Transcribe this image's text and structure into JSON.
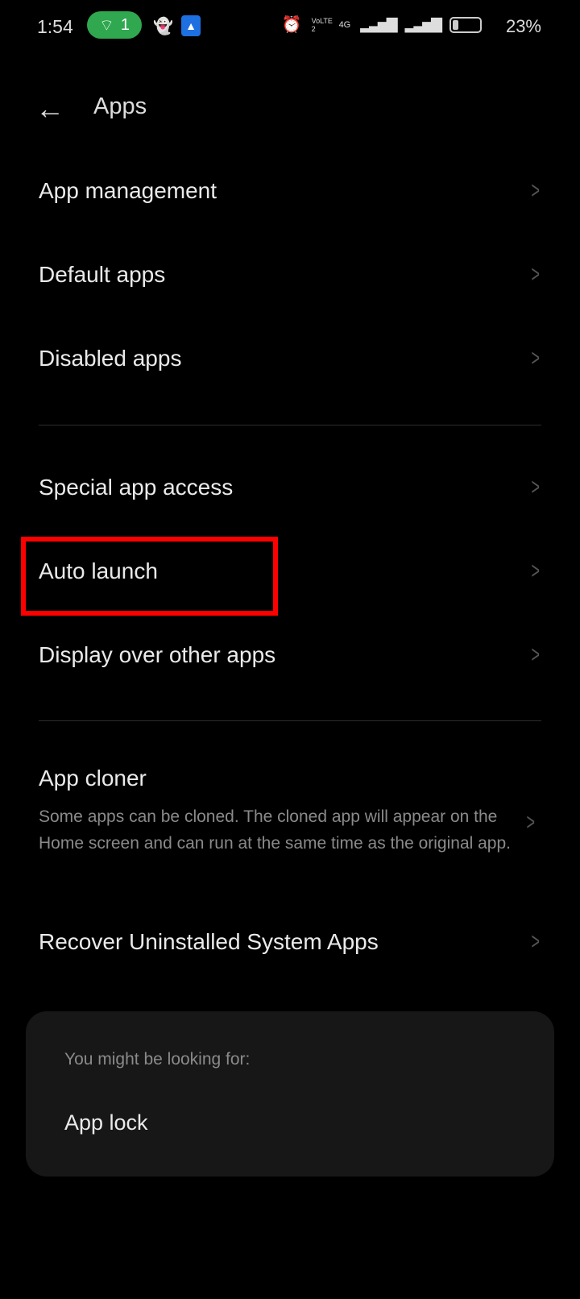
{
  "status_bar": {
    "time": "1:54",
    "hotspot_count": "1",
    "network": "4G",
    "volte": "VoLTE 2",
    "battery": "23%",
    "battery_level": 0.23,
    "icons": [
      "hotspot-icon",
      "snapchat-icon",
      "android-icon",
      "alarm-icon",
      "signal-icon",
      "battery-icon"
    ]
  },
  "header": {
    "title": "Apps",
    "back_icon": "arrow-left-icon"
  },
  "items": [
    {
      "label": "App management"
    },
    {
      "label": "Default apps"
    },
    {
      "label": "Disabled apps"
    },
    {
      "label": "Special app access"
    },
    {
      "label": "Auto launch"
    },
    {
      "label": "Display over other apps"
    },
    {
      "label": "App cloner",
      "subtitle": "Some apps can be cloned. The cloned app will appear on the Home screen and can run at the same time as the original app."
    },
    {
      "label": "Recover Uninstalled System Apps"
    }
  ],
  "suggestions": {
    "heading": "You might be looking for:",
    "items": [
      "App lock"
    ]
  },
  "highlight_color": "#ff0000"
}
